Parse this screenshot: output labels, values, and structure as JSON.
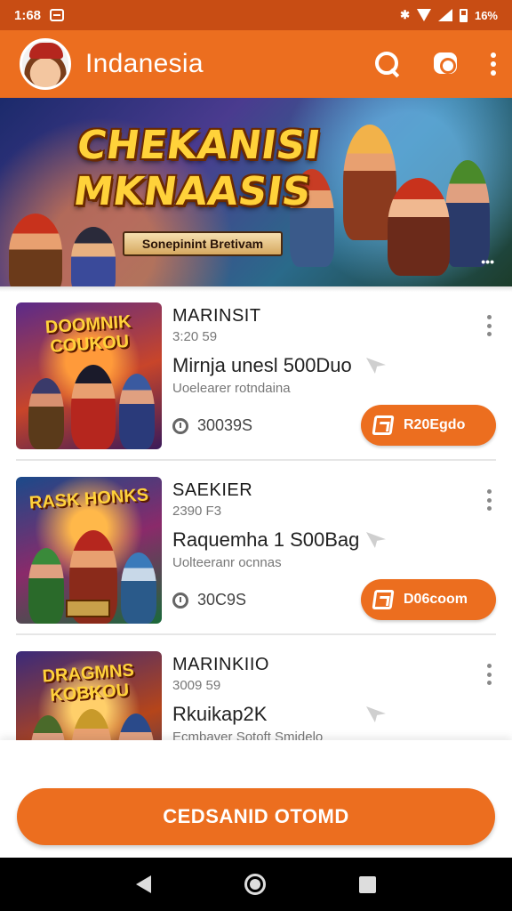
{
  "status_bar": {
    "time": "1:68",
    "battery_text": "16%"
  },
  "header": {
    "title": "Indanesia",
    "icons": [
      "avatar",
      "search-icon",
      "chat-icon",
      "more-vert-icon"
    ]
  },
  "banner": {
    "title_line1": "CHEKANISI",
    "title_line2": "MKNAASIS",
    "subtitle": "Sonepinint Bretivam",
    "dots": "•••"
  },
  "cards": [
    {
      "thumb_title": "DOOMNIK COUKOU",
      "title": "MARINSIT",
      "sub": "3:20 59",
      "desc": "Mirnja unesl 500Duo",
      "desc2": "Uoelearer rotndaina",
      "meta": "30039S",
      "button": "R20Egdo"
    },
    {
      "thumb_title": "RASK HONKS",
      "title": "SAEKIER",
      "sub": "2390 F3",
      "desc": "Raquemha 1 S00Bag",
      "desc2": "Uolteeranr ocnnas",
      "meta": "30C9S",
      "button": "D06coom"
    },
    {
      "thumb_title": "DRAGMNS KOBKOU",
      "title": "MARINKIIO",
      "sub": "3009 59",
      "desc": "Rkuikap2K",
      "desc2": "Ecmbaver Sotoft Smidelo",
      "meta": "",
      "button": ""
    }
  ],
  "cta": {
    "label": "CEDSANID OTOMD"
  },
  "colors": {
    "primary": "#ec6e1f",
    "status_bar": "#c84d14",
    "title_gold": "#ffd23a"
  }
}
